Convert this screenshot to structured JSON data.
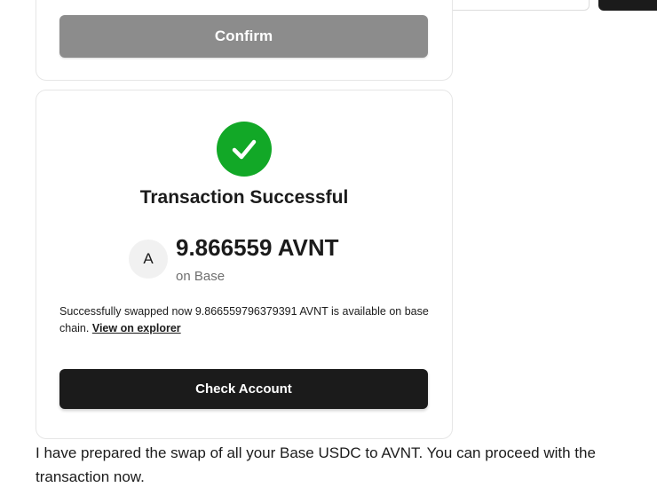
{
  "confirm_card": {
    "button_label": "Confirm"
  },
  "success_card": {
    "icon": "check-icon",
    "title": "Transaction Successful",
    "token": {
      "avatar_letter": "A",
      "amount": "9.866559 AVNT",
      "network": "on Base"
    },
    "message": "Successfully swapped now 9.866559796379391 AVNT is available on base chain.",
    "explorer_link": "View on explorer",
    "button_label": "Check Account"
  },
  "chat": {
    "message": "I have prepared the swap of all your Base USDC to AVNT. You can proceed with the transaction now."
  },
  "colors": {
    "success_green": "#12a827",
    "dark_button": "#1b1b1b",
    "disabled_button": "#8c8c8c"
  }
}
